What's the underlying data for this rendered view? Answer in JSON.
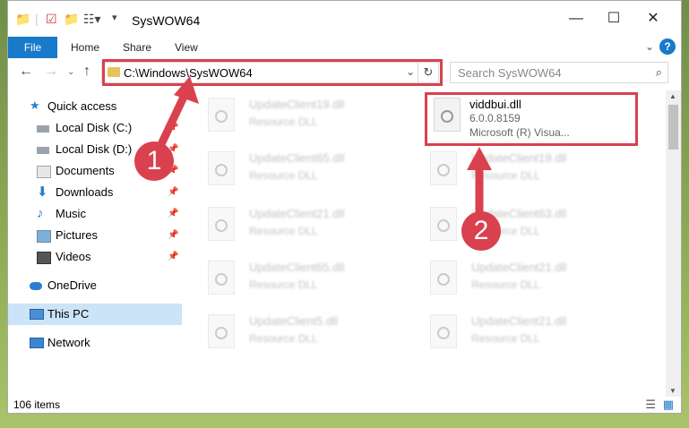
{
  "window": {
    "title": "SysWOW64",
    "controls": {
      "minimize": "—",
      "maximize": "☐",
      "close": "✕"
    }
  },
  "ribbon": {
    "tabs": [
      {
        "label": "File"
      },
      {
        "label": "Home"
      },
      {
        "label": "Share"
      },
      {
        "label": "View"
      }
    ],
    "help": "?"
  },
  "navigation": {
    "address": "C:\\Windows\\SysWOW64",
    "search_placeholder": "Search SysWOW64"
  },
  "sidebar": {
    "items": [
      {
        "label": "Quick access",
        "icon": "star-icon",
        "pinned": false
      },
      {
        "label": "Local Disk (C:)",
        "icon": "drive-icon",
        "pinned": true
      },
      {
        "label": "Local Disk (D:)",
        "icon": "drive-icon",
        "pinned": true
      },
      {
        "label": "Documents",
        "icon": "documents-icon",
        "pinned": true
      },
      {
        "label": "Downloads",
        "icon": "download-icon",
        "pinned": true
      },
      {
        "label": "Music",
        "icon": "music-icon",
        "pinned": true
      },
      {
        "label": "Pictures",
        "icon": "pictures-icon",
        "pinned": true
      },
      {
        "label": "Videos",
        "icon": "videos-icon",
        "pinned": true
      },
      {
        "label": "OneDrive",
        "icon": "cloud-icon",
        "pinned": false
      },
      {
        "label": "This PC",
        "icon": "computer-icon",
        "pinned": false,
        "selected": true
      },
      {
        "label": "Network",
        "icon": "network-icon",
        "pinned": false
      }
    ]
  },
  "files": {
    "left": [
      {
        "name": "UpdateClient19.dll",
        "type": "Resource DLL"
      },
      {
        "name": "UpdateClient65.dll",
        "type": "Resource DLL"
      },
      {
        "name": "UpdateClient21.dll",
        "type": "Resource DLL"
      },
      {
        "name": "UpdateClient65.dll",
        "type": "Resource DLL"
      },
      {
        "name": "UpdateClient5.dll",
        "type": "Resource DLL"
      }
    ],
    "right": [
      {
        "name": "UpdateClient19.dll",
        "type": "Resource DLL"
      },
      {
        "name": "UpdateClient63.dll",
        "type": "Resource DLL"
      },
      {
        "name": "UpdateClient21.dll",
        "type": "Resource DLL"
      },
      {
        "name": "UpdateClient21.dll",
        "type": "Resource DLL"
      }
    ],
    "highlighted": {
      "name": "viddbui.dll",
      "version": "6.0.0.8159",
      "description": "Microsoft (R) Visua..."
    }
  },
  "status": {
    "item_count": "106 items"
  },
  "annotations": {
    "badge1": "1",
    "badge2": "2"
  },
  "colors": {
    "accent": "#1979ca",
    "annotation": "#d9414f"
  }
}
